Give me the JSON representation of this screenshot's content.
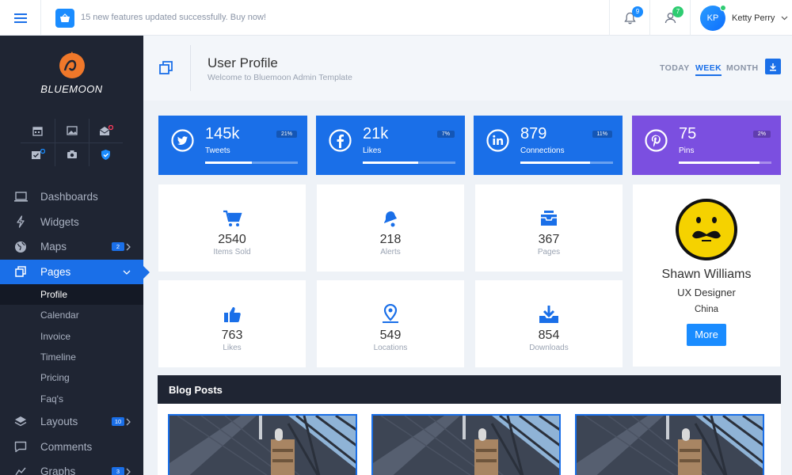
{
  "topbar": {
    "notice": "15 new features updated successfully. Buy now!",
    "notifications_count": "9",
    "users_count": "7",
    "user_initials": "KP",
    "user_name": "Ketty Perry"
  },
  "sidebar": {
    "brand": "BLUEMOON",
    "nav": [
      {
        "label": "Dashboards",
        "icon": "laptop-icon"
      },
      {
        "label": "Widgets",
        "icon": "bolt-icon"
      },
      {
        "label": "Maps",
        "icon": "globe-icon",
        "badge": "2"
      },
      {
        "label": "Pages",
        "icon": "copy-icon"
      },
      {
        "label": "Layouts",
        "icon": "layers-icon",
        "badge": "10"
      },
      {
        "label": "Comments",
        "icon": "comment-icon"
      },
      {
        "label": "Graphs",
        "icon": "chart-icon",
        "badge": "3"
      }
    ],
    "pages_sub": [
      "Profile",
      "Calendar",
      "Invoice",
      "Timeline",
      "Pricing",
      "Faq's"
    ],
    "active_sub": "Profile"
  },
  "header": {
    "title": "User Profile",
    "subtitle": "Welcome to Bluemoon Admin Template",
    "tabs": [
      "TODAY",
      "WEEK",
      "MONTH"
    ],
    "active_tab": "WEEK"
  },
  "social": [
    {
      "value": "145k",
      "label": "Tweets",
      "percent": "21%",
      "progress": 0.5,
      "color": "#1a6fe8",
      "icon": "twitter-icon"
    },
    {
      "value": "21k",
      "label": "Likes",
      "percent": "7%",
      "progress": 0.6,
      "color": "#1a6fe8",
      "icon": "facebook-icon"
    },
    {
      "value": "879",
      "label": "Connections",
      "percent": "11%",
      "progress": 0.75,
      "color": "#1a6fe8",
      "icon": "linkedin-icon"
    },
    {
      "value": "75",
      "label": "Pins",
      "percent": "2%",
      "progress": 0.87,
      "color": "#7b4fe0",
      "icon": "pinterest-icon"
    }
  ],
  "stats": [
    {
      "value": "2540",
      "label": "Items Sold",
      "icon": "cart-icon"
    },
    {
      "value": "218",
      "label": "Alerts",
      "icon": "bell-icon"
    },
    {
      "value": "367",
      "label": "Pages",
      "icon": "inbox-icon"
    },
    {
      "value": "763",
      "label": "Likes",
      "icon": "thumbs-up-icon"
    },
    {
      "value": "549",
      "label": "Locations",
      "icon": "location-pin-icon"
    },
    {
      "value": "854",
      "label": "Downloads",
      "icon": "download-icon"
    }
  ],
  "profile": {
    "name": "Shawn Williams",
    "role": "UX Designer",
    "country": "China",
    "more_label": "More"
  },
  "blog": {
    "title": "Blog Posts"
  },
  "colors": {
    "accent": "#1a6fe8",
    "sidebar": "#1f2533",
    "purple": "#7b4fe0"
  }
}
